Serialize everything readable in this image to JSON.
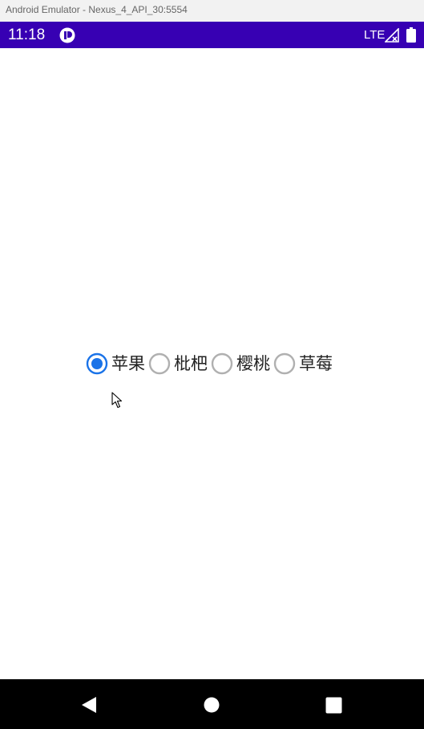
{
  "window": {
    "title": "Android Emulator - Nexus_4_API_30:5554"
  },
  "status_bar": {
    "time": "11:18",
    "network": "LTE",
    "background_color": "#3700b3"
  },
  "radio_group": {
    "accent_color": "#1a73e8",
    "options": [
      {
        "label": "苹果",
        "checked": true
      },
      {
        "label": "枇杷",
        "checked": false
      },
      {
        "label": "樱桃",
        "checked": false
      },
      {
        "label": "草莓",
        "checked": false
      }
    ]
  },
  "nav_bar": {
    "icons": [
      "back-icon",
      "home-icon",
      "recents-icon"
    ]
  }
}
